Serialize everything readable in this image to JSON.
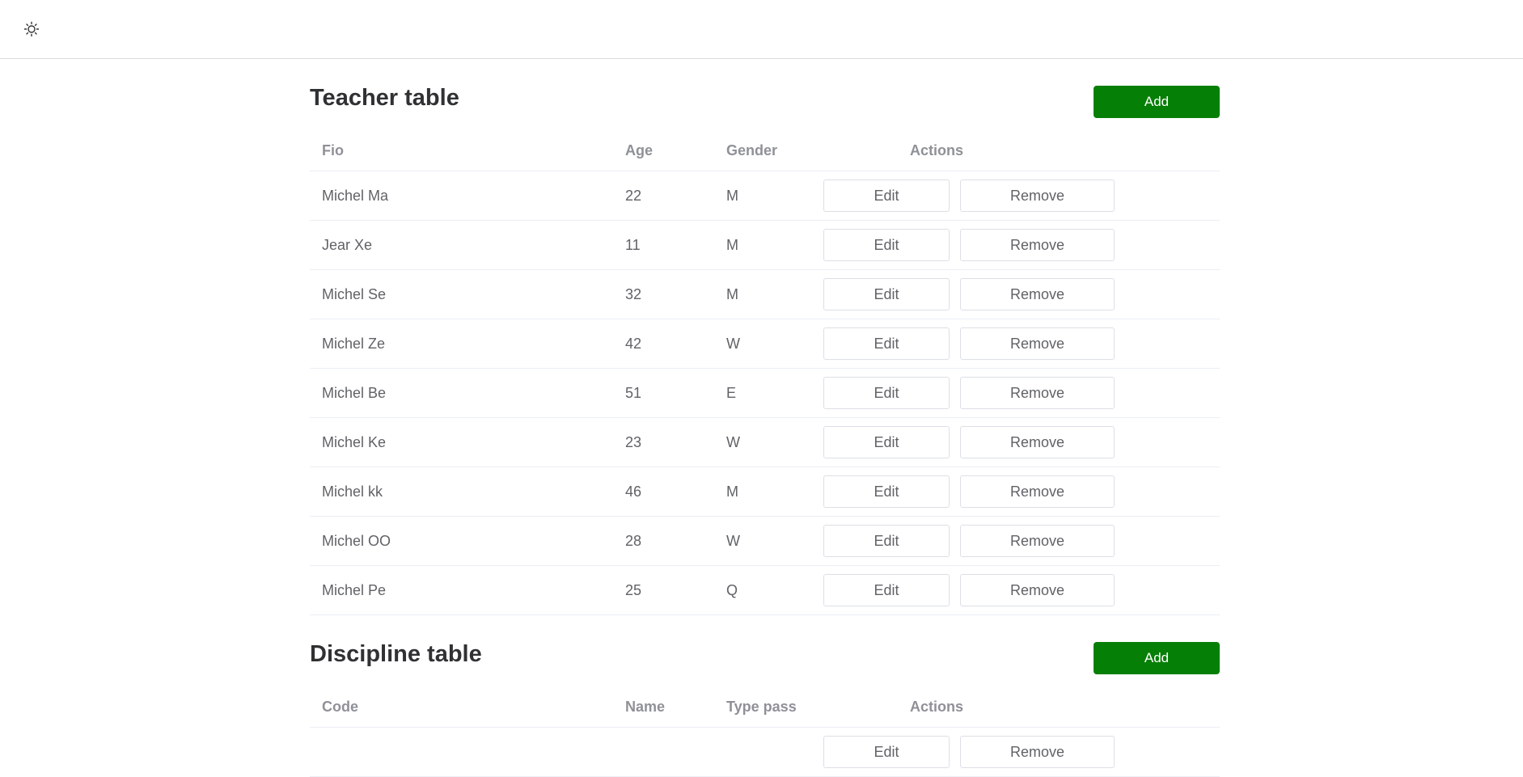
{
  "header": {
    "theme_icon": "sun-icon"
  },
  "teacher": {
    "title": "Teacher table",
    "add_label": "Add",
    "columns": [
      "Fio",
      "Age",
      "Gender",
      "Actions"
    ],
    "edit_label": "Edit",
    "remove_label": "Remove",
    "rows": [
      {
        "fio": "Michel Ma",
        "age": "22",
        "gender": "M"
      },
      {
        "fio": "Jear Xe",
        "age": "11",
        "gender": "M"
      },
      {
        "fio": "Michel Se",
        "age": "32",
        "gender": "M"
      },
      {
        "fio": "Michel Ze",
        "age": "42",
        "gender": "W"
      },
      {
        "fio": "Michel Be",
        "age": "51",
        "gender": "E"
      },
      {
        "fio": "Michel Ke",
        "age": "23",
        "gender": "W"
      },
      {
        "fio": "Michel kk",
        "age": "46",
        "gender": "M"
      },
      {
        "fio": "Michel OO",
        "age": "28",
        "gender": "W"
      },
      {
        "fio": "Michel Pe",
        "age": "25",
        "gender": "Q"
      }
    ]
  },
  "discipline": {
    "title": "Discipline table",
    "add_label": "Add",
    "columns": [
      "Code",
      "Name",
      "Type pass",
      "Actions"
    ],
    "edit_label": "Edit",
    "remove_label": "Remove"
  }
}
